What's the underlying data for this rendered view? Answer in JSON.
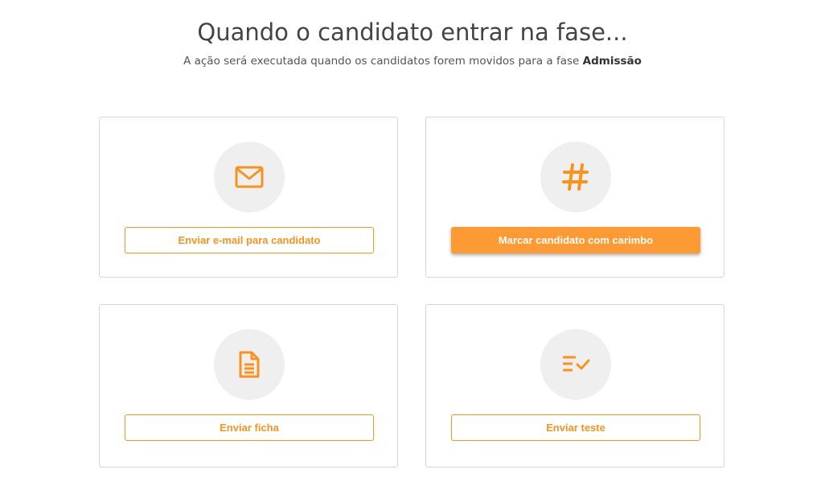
{
  "header": {
    "title": "Quando o candidato entrar na fase...",
    "subtitle_prefix": "A ação será executada quando os candidatos forem movidos para a fase ",
    "stage_name": "Admissão"
  },
  "colors": {
    "accent": "#f7931e",
    "accent_filled": "#fd9a33",
    "icon_bg": "#efefef"
  },
  "actions": [
    {
      "icon": "mail-icon",
      "label": "Enviar e-mail para candidato",
      "state": "outline"
    },
    {
      "icon": "hash-icon",
      "label": "Marcar candidato com carimbo",
      "state": "filled"
    },
    {
      "icon": "document-icon",
      "label": "Enviar ficha",
      "state": "outline"
    },
    {
      "icon": "checklist-icon",
      "label": "Enviar teste",
      "state": "outline"
    }
  ]
}
